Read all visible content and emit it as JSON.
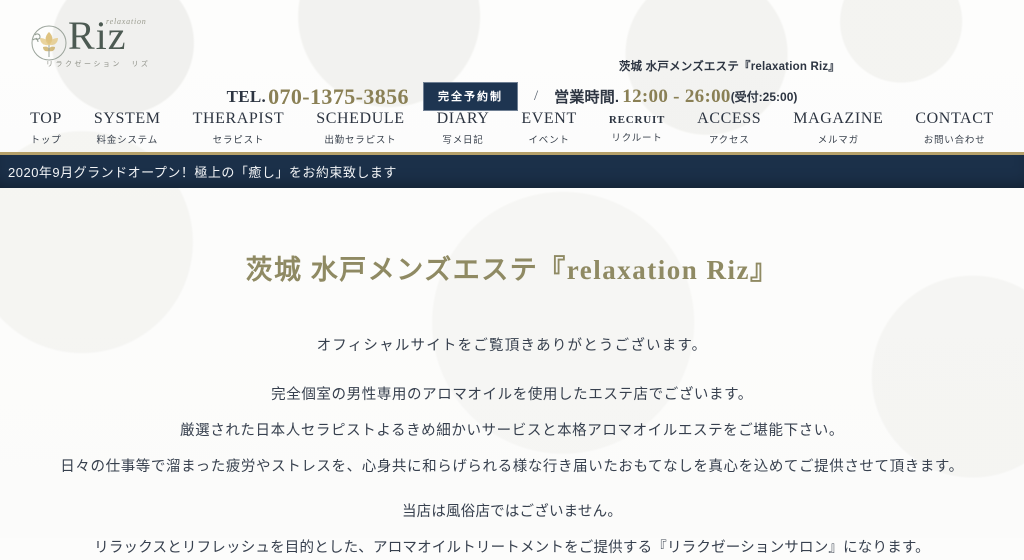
{
  "logo": {
    "brand": "Riz",
    "script": "relaxation",
    "kana": "リラクゼーション　リズ",
    "emblem_icon": "flower-circle-icon"
  },
  "header": {
    "shop_name": "茨城 水戸メンズエステ『relaxation Riz』",
    "tel_label": "TEL.",
    "tel_number": "070-1375-3856",
    "reserve_badge": "完全予約制",
    "separator": "/",
    "hours_label": "営業時間.",
    "hours_range": "12:00 - 26:00",
    "hours_note": "(受付:25:00)"
  },
  "nav": {
    "items": [
      {
        "en": "TOP",
        "ja": "トップ",
        "small": false
      },
      {
        "en": "SYSTEM",
        "ja": "料金システム",
        "small": false
      },
      {
        "en": "THERAPIST",
        "ja": "セラピスト",
        "small": false
      },
      {
        "en": "SCHEDULE",
        "ja": "出勤セラピスト",
        "small": false
      },
      {
        "en": "DIARY",
        "ja": "写メ日記",
        "small": false
      },
      {
        "en": "EVENT",
        "ja": "イベント",
        "small": false
      },
      {
        "en": "RECRUIT",
        "ja": "リクルート",
        "small": true
      },
      {
        "en": "ACCESS",
        "ja": "アクセス",
        "small": false
      },
      {
        "en": "MAGAZINE",
        "ja": "メルマガ",
        "small": false
      },
      {
        "en": "CONTACT",
        "ja": "お問い合わせ",
        "small": false
      }
    ]
  },
  "notice": {
    "text": "2020年9月グランドオープン！極上の「癒し」をお約束致します"
  },
  "main": {
    "title": "茨城 水戸メンズエステ『relaxation Riz』",
    "lead": "オフィシャルサイトをご覧頂きありがとうございます。",
    "paragraph1": [
      "完全個室の男性専用のアロマオイルを使用したエステ店でございます。",
      "厳選された日本人セラピストよるきめ細かいサービスと本格アロマオイルエステをご堪能下さい。",
      "日々の仕事等で溜まった疲労やストレスを、心身共に和らげられる様な行き届いたおもてなしを真心を込めてご提供させて頂きます。"
    ],
    "paragraph2": [
      "当店は風俗店ではございません。",
      "リラックスとリフレッシュを目的とした、アロマオイルトリートメントをご提供する『リラクゼーションサロン』になります。"
    ]
  },
  "colors": {
    "navy": "#1b3049",
    "gold": "#b5a06a",
    "tel_gold": "#8a8055",
    "title_gold": "#8f8a63",
    "text": "#37404e",
    "background": "#fcfcfb"
  }
}
